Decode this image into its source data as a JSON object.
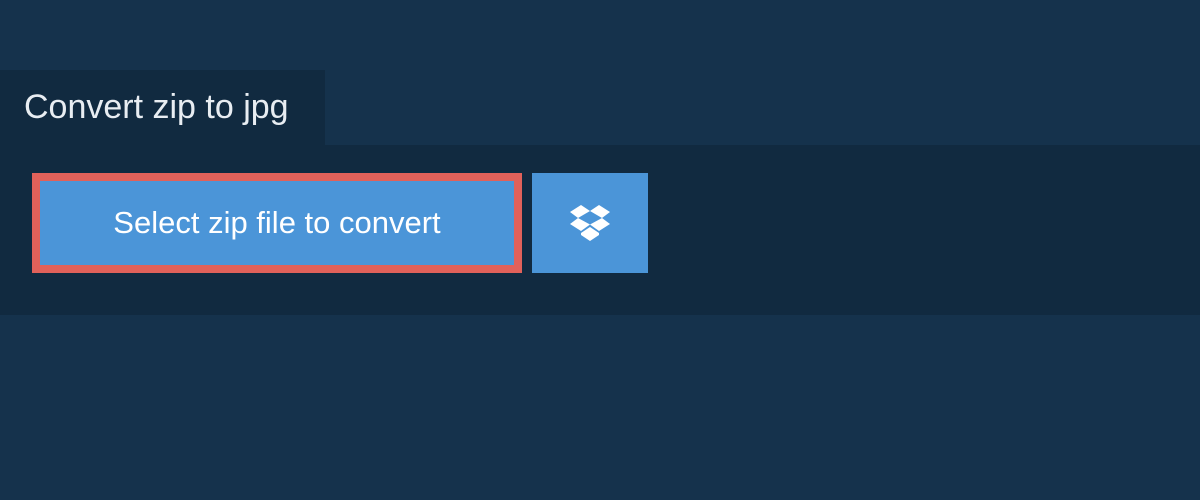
{
  "tab": {
    "title": "Convert zip to jpg"
  },
  "uploader": {
    "select_label": "Select zip file to convert",
    "dropbox_icon_name": "dropbox-icon"
  },
  "colors": {
    "page_bg": "#15324c",
    "panel_bg": "#112a40",
    "button_bg": "#4b95d8",
    "highlight_border": "#e1615a",
    "text": "#ffffff"
  }
}
